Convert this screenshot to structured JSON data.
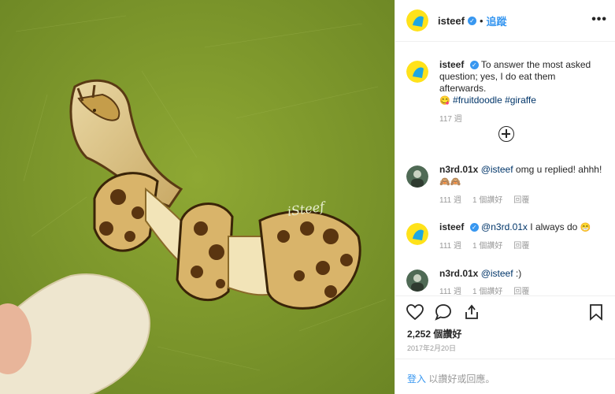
{
  "post": {
    "username": "isteef",
    "verified_icon": "verified-badge-icon",
    "separator": "•",
    "follow_label": "追蹤",
    "more_icon": "more-options-icon",
    "more_glyph": "•••"
  },
  "photo": {
    "watermark": "iSteef",
    "description_icon": "banana-giraffe-photo"
  },
  "comments": [
    {
      "username": "isteef",
      "text": "To answer the most asked question; yes, I do eat them afterwards.",
      "emoji": "😋",
      "tags": "#fruitdoodle #giraffe",
      "time": "117 週"
    },
    {
      "username": "n3rd.01x",
      "mention": "@isteef",
      "text": " omg u replied! ahhh!",
      "emoji": "🙈🙈",
      "time": "111 週",
      "likes": "1 個讚好",
      "reply": "回覆"
    },
    {
      "username": "isteef",
      "mention": "@n3rd.01x",
      "text": " I always do ",
      "emoji": "😁",
      "time": "111 週",
      "likes": "1 個讚好",
      "reply": "回覆"
    },
    {
      "username": "n3rd.01x",
      "mention": "@isteef",
      "text": " :)",
      "time": "111 週",
      "likes": "1 個讚好",
      "reply": "回覆"
    }
  ],
  "actions": {
    "like_icon": "heart-icon",
    "comment_icon": "comment-icon",
    "share_icon": "share-icon",
    "save_icon": "bookmark-icon",
    "likes_count": "2,252 個讚好",
    "date": "2017年2月20日"
  },
  "login": {
    "link": "登入",
    "text": " 以讚好或回應。"
  },
  "colors": {
    "accent": "#3897f0",
    "photo_bg": "#7f9a2c",
    "isteef_avatar_bg": "#ffe21a",
    "isteef_avatar_accent": "#1ea7e1"
  }
}
